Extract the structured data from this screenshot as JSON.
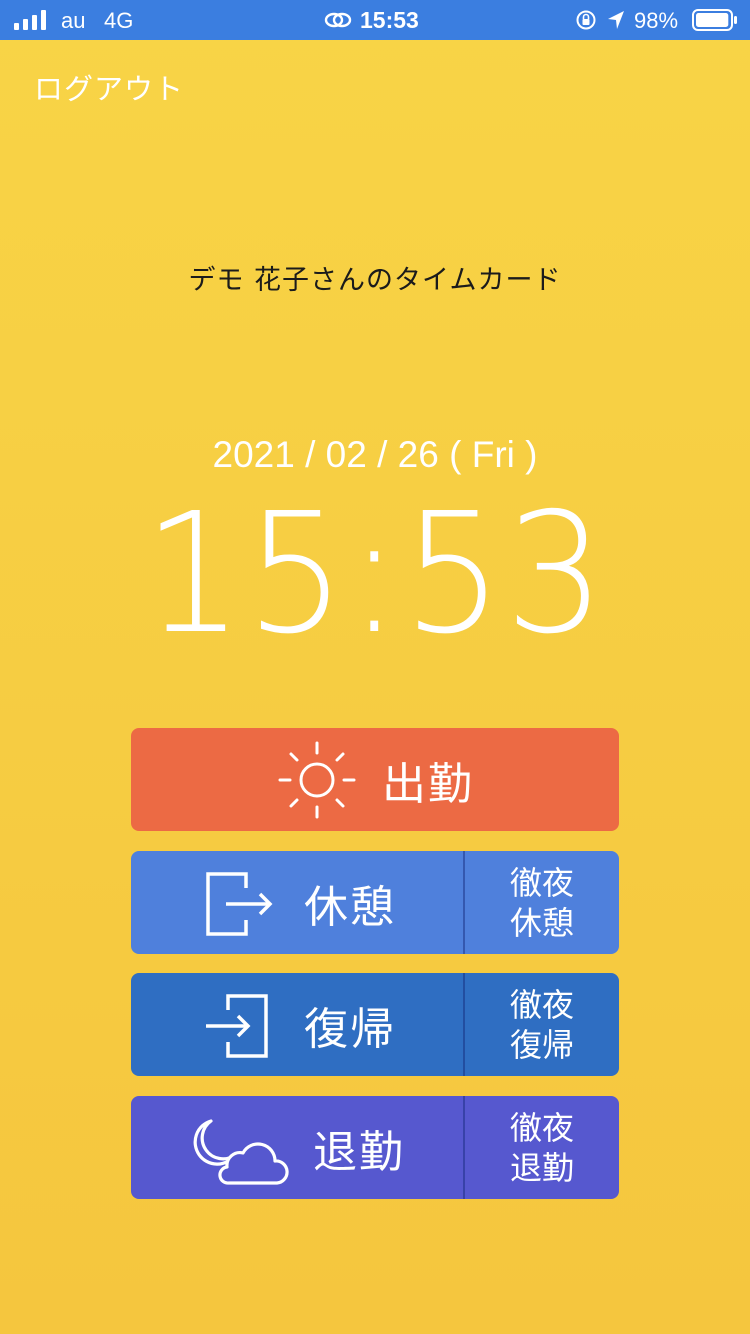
{
  "status_bar": {
    "carrier": "au",
    "network": "4G",
    "time": "15:53",
    "battery": "98%",
    "battery_level": 0.98
  },
  "header": {
    "logout_label": "ログアウト"
  },
  "title": "デモ 花子さんのタイムカード",
  "date": "2021 / 02 / 26 ( Fri )",
  "clock": "15:53",
  "buttons": {
    "clock_in": {
      "label": "出勤",
      "icon": "sun-icon"
    },
    "break": {
      "label": "休憩",
      "icon": "exit-door-icon",
      "overnight_line1": "徹夜",
      "overnight_line2": "休憩"
    },
    "return": {
      "label": "復帰",
      "icon": "enter-door-icon",
      "overnight_line1": "徹夜",
      "overnight_line2": "復帰"
    },
    "clock_out": {
      "label": "退勤",
      "icon": "moon-cloud-icon",
      "overnight_line1": "徹夜",
      "overnight_line2": "退勤"
    }
  },
  "colors": {
    "background": "#f7cf43",
    "status_bar": "#3b7ee0",
    "clock_in": "#ec6a44",
    "break": "#4f80dc",
    "return": "#2f6ec2",
    "clock_out": "#5658cf"
  }
}
